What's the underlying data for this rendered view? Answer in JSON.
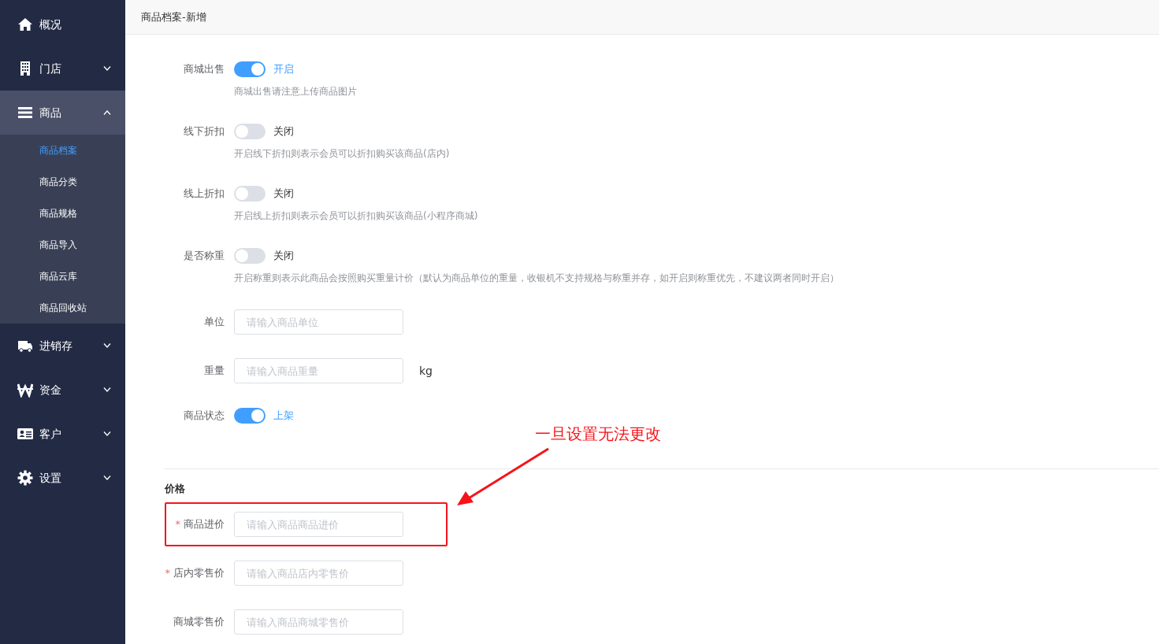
{
  "sidebar": {
    "items": [
      {
        "kind": "link",
        "label": "概况"
      },
      {
        "kind": "group",
        "label": "门店",
        "expanded": false
      },
      {
        "kind": "group",
        "label": "商品",
        "expanded": true,
        "children": [
          {
            "label": "商品档案",
            "selected": true
          },
          {
            "label": "商品分类",
            "selected": false
          },
          {
            "label": "商品规格",
            "selected": false
          },
          {
            "label": "商品导入",
            "selected": false
          },
          {
            "label": "商品云库",
            "selected": false
          },
          {
            "label": "商品回收站",
            "selected": false
          }
        ]
      },
      {
        "kind": "group",
        "label": "进销存",
        "expanded": false
      },
      {
        "kind": "group",
        "label": "资金",
        "expanded": false
      },
      {
        "kind": "group",
        "label": "客户",
        "expanded": false
      },
      {
        "kind": "group",
        "label": "设置",
        "expanded": false
      }
    ]
  },
  "page_title": "商品档案-新增",
  "form": {
    "rows": [
      {
        "kind": "toggle",
        "label": "商城出售",
        "on": true,
        "state_text": "开启",
        "hint": "商城出售请注意上传商品图片"
      },
      {
        "kind": "toggle",
        "label": "线下折扣",
        "on": false,
        "state_text": "关闭",
        "hint": "开启线下折扣则表示会员可以折扣购买该商品(店内)"
      },
      {
        "kind": "toggle",
        "label": "线上折扣",
        "on": false,
        "state_text": "关闭",
        "hint": "开启线上折扣则表示会员可以折扣购买该商品(小程序商城)"
      },
      {
        "kind": "toggle",
        "label": "是否称重",
        "on": false,
        "state_text": "关闭",
        "hint": "开启称重则表示此商品会按照购买重量计价（默认为商品单位的重量，收银机不支持规格与称重并存，如开启则称重优先，不建议两者同时开启）"
      },
      {
        "kind": "input",
        "label": "单位",
        "placeholder": "请输入商品单位"
      },
      {
        "kind": "input",
        "label": "重量",
        "placeholder": "请输入商品重量",
        "unit": "kg"
      },
      {
        "kind": "toggle",
        "label": "商品状态",
        "on": true,
        "state_text": "上架"
      }
    ]
  },
  "price": {
    "title": "价格",
    "rows": [
      {
        "label": "商品进价",
        "required_mark": "*",
        "highlighted": true,
        "placeholder": "请输入商品商品进价"
      },
      {
        "label": "店内零售价",
        "required_mark": "*",
        "highlighted": false,
        "placeholder": "请输入商品店内零售价"
      },
      {
        "label": "商城零售价",
        "highlighted": false,
        "placeholder": "请输入商品商城零售价"
      }
    ]
  },
  "annotation": {
    "text": "一旦设置无法更改"
  }
}
